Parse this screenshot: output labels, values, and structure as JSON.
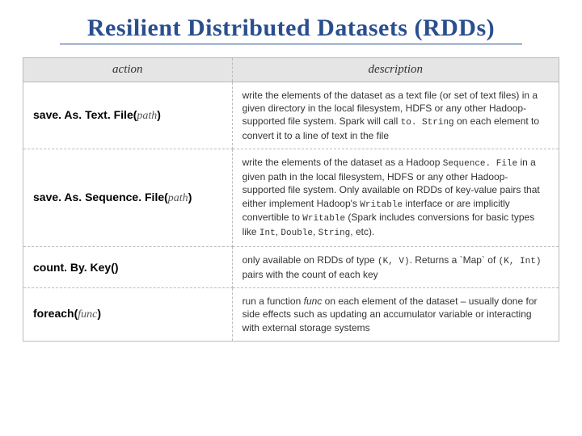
{
  "title": "Resilient Distributed Datasets (RDDs)",
  "headers": {
    "action": "action",
    "description": "description"
  },
  "rows": [
    {
      "action_name": "save. As. Text. File",
      "action_param": "path",
      "desc_parts": [
        "write the elements of the dataset as a text file (or set of text files) in a given directory in the local filesystem, HDFS or any other Hadoop-supported file system. Spark will call ",
        {
          "code": "to. String"
        },
        " on each element to convert it to a line of text in the file"
      ]
    },
    {
      "action_name": "save. As. Sequence. File",
      "action_param": "path",
      "desc_parts": [
        "write the elements of the dataset as a Hadoop ",
        {
          "code": "Sequence. File"
        },
        " in a given path in the local filesystem, HDFS or any other Hadoop-supported file system. Only available on RDDs of key-value pairs that either implement Hadoop's ",
        {
          "code": "Writable"
        },
        " interface or are implicitly convertible to ",
        {
          "code": "Writable"
        },
        " (Spark includes conversions for basic types like ",
        {
          "code": "Int"
        },
        ", ",
        {
          "code": "Double"
        },
        ", ",
        {
          "code": "String"
        },
        ", etc)."
      ]
    },
    {
      "action_name": "count. By. Key",
      "action_param": "",
      "desc_parts": [
        "only available on RDDs of type ",
        {
          "code": "(K, V)"
        },
        ". Returns a `Map` of ",
        {
          "code": "(K, Int)"
        },
        " pairs with the count of each key"
      ]
    },
    {
      "action_name": "foreach",
      "action_param": "func",
      "desc_parts": [
        "run a function ",
        {
          "i": "func"
        },
        " on each element of the dataset – usually done for side effects such as updating an accumulator variable or interacting with external storage systems"
      ]
    }
  ]
}
